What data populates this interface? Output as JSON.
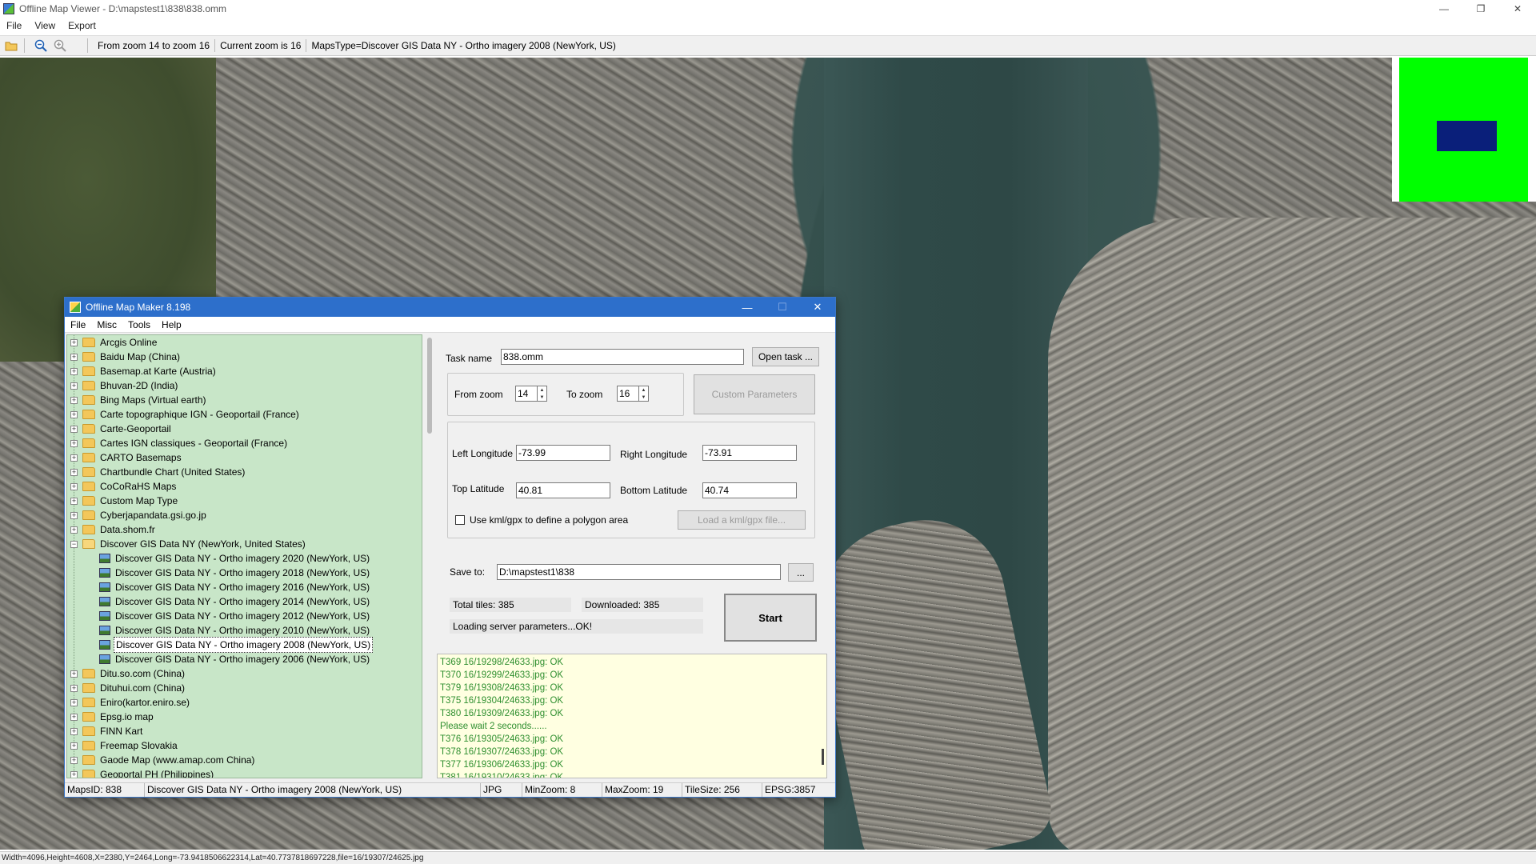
{
  "window": {
    "title": "Offline Map Viewer - D:\\mapstest1\\838\\838.omm",
    "controls": {
      "minimize": "—",
      "restore": "❐",
      "close": "✕"
    }
  },
  "menu": [
    "File",
    "View",
    "Export"
  ],
  "toolbar": {
    "zoom_range": "From zoom 14 to zoom 16",
    "current_zoom": "Current zoom is 16",
    "maps_type": "MapsType=Discover GIS Data NY - Ortho imagery 2008 (NewYork, US)"
  },
  "statusbar": {
    "text": "Width=4096,Height=4608,X=2380,Y=2464,Long=-73.9418506622314,Lat=40.7737818697228,file=16/19307/24625.jpg"
  },
  "minimap": {
    "frame_color": "#00ff00",
    "view_color": "#0a1f7a"
  },
  "dialog": {
    "title": "Offline Map Maker 8.198",
    "controls": {
      "minimize": "—",
      "maximize": "☐",
      "close": "✕"
    },
    "menu": [
      "File",
      "Misc",
      "Tools",
      "Help"
    ],
    "tree": [
      {
        "label": "Arcgis Online",
        "level": 0,
        "expanded": false
      },
      {
        "label": "Baidu Map (China)",
        "level": 0,
        "expanded": false
      },
      {
        "label": "Basemap.at Karte (Austria)",
        "level": 0,
        "expanded": false
      },
      {
        "label": "Bhuvan-2D (India)",
        "level": 0,
        "expanded": false
      },
      {
        "label": "Bing Maps (Virtual earth)",
        "level": 0,
        "expanded": false
      },
      {
        "label": "Carte topographique IGN - Geoportail (France)",
        "level": 0,
        "expanded": false
      },
      {
        "label": "Carte-Geoportail",
        "level": 0,
        "expanded": false
      },
      {
        "label": "Cartes IGN classiques - Geoportail (France)",
        "level": 0,
        "expanded": false
      },
      {
        "label": "CARTO Basemaps",
        "level": 0,
        "expanded": false
      },
      {
        "label": "Chartbundle Chart (United States)",
        "level": 0,
        "expanded": false
      },
      {
        "label": "CoCoRaHS Maps",
        "level": 0,
        "expanded": false
      },
      {
        "label": "Custom Map Type",
        "level": 0,
        "expanded": false
      },
      {
        "label": "Cyberjapandata.gsi.go.jp",
        "level": 0,
        "expanded": false
      },
      {
        "label": "Data.shom.fr",
        "level": 0,
        "expanded": false
      },
      {
        "label": "Discover GIS Data NY (NewYork, United States)",
        "level": 0,
        "expanded": true
      },
      {
        "label": "Discover GIS Data NY - Ortho imagery 2020 (NewYork, US)",
        "level": 1
      },
      {
        "label": "Discover GIS Data NY - Ortho imagery 2018 (NewYork, US)",
        "level": 1
      },
      {
        "label": "Discover GIS Data NY - Ortho imagery 2016 (NewYork, US)",
        "level": 1
      },
      {
        "label": "Discover GIS Data NY - Ortho imagery 2014 (NewYork, US)",
        "level": 1
      },
      {
        "label": "Discover GIS Data NY - Ortho imagery 2012 (NewYork, US)",
        "level": 1
      },
      {
        "label": "Discover GIS Data NY - Ortho imagery 2010 (NewYork, US)",
        "level": 1
      },
      {
        "label": "Discover GIS Data NY - Ortho imagery 2008 (NewYork, US)",
        "level": 1,
        "selected": true
      },
      {
        "label": "Discover GIS Data NY - Ortho imagery 2006 (NewYork, US)",
        "level": 1
      },
      {
        "label": "Ditu.so.com (China)",
        "level": 0,
        "expanded": false
      },
      {
        "label": "Dituhui.com (China)",
        "level": 0,
        "expanded": false
      },
      {
        "label": "Eniro(kartor.eniro.se)",
        "level": 0,
        "expanded": false
      },
      {
        "label": "Epsg.io map",
        "level": 0,
        "expanded": false
      },
      {
        "label": "FINN Kart",
        "level": 0,
        "expanded": false
      },
      {
        "label": "Freemap Slovakia",
        "level": 0,
        "expanded": false
      },
      {
        "label": "Gaode Map (www.amap.com China)",
        "level": 0,
        "expanded": false
      },
      {
        "label": "Geoportal PH (Philippines)",
        "level": 0,
        "expanded": false
      }
    ],
    "task": {
      "name_label": "Task name",
      "name_value": "838.omm",
      "open_button": "Open task ...",
      "from_zoom_label": "From zoom",
      "from_zoom_value": "14",
      "to_zoom_label": "To zoom",
      "to_zoom_value": "16",
      "custom_params_button": "Custom Parameters",
      "left_lon_label": "Left Longitude",
      "left_lon_value": "-73.99",
      "right_lon_label": "Right Longitude",
      "right_lon_value": "-73.91",
      "top_lat_label": "Top Latitude",
      "top_lat_value": "40.81",
      "bottom_lat_label": "Bottom Latitude",
      "bottom_lat_value": "40.74",
      "kml_checkbox_label": "Use kml/gpx to define a polygon area",
      "kml_button": "Load a kml/gpx file...",
      "save_to_label": "Save to:",
      "save_to_value": "D:\\mapstest1\\838",
      "browse_button": "...",
      "total_tiles": "Total tiles: 385",
      "downloaded": "Downloaded: 385",
      "loading_status": "Loading server parameters...OK!",
      "start_button": "Start"
    },
    "log": [
      "T369 16/19298/24633.jpg: OK",
      "T370 16/19299/24633.jpg: OK",
      "T379 16/19308/24633.jpg: OK",
      "T375 16/19304/24633.jpg: OK",
      "T380 16/19309/24633.jpg: OK",
      "Please wait 2 seconds......",
      "T376 16/19305/24633.jpg: OK",
      "T378 16/19307/24633.jpg: OK",
      "T377 16/19306/24633.jpg: OK",
      "T381 16/19310/24633.jpg: OK"
    ],
    "status": {
      "maps_id": "MapsID: 838",
      "map_name": "Discover GIS Data NY - Ortho imagery 2008 (NewYork, US)",
      "format": "JPG",
      "min_zoom": "MinZoom: 8",
      "max_zoom": "MaxZoom: 19",
      "tile_size": "TileSize: 256",
      "epsg": "EPSG:3857"
    }
  }
}
